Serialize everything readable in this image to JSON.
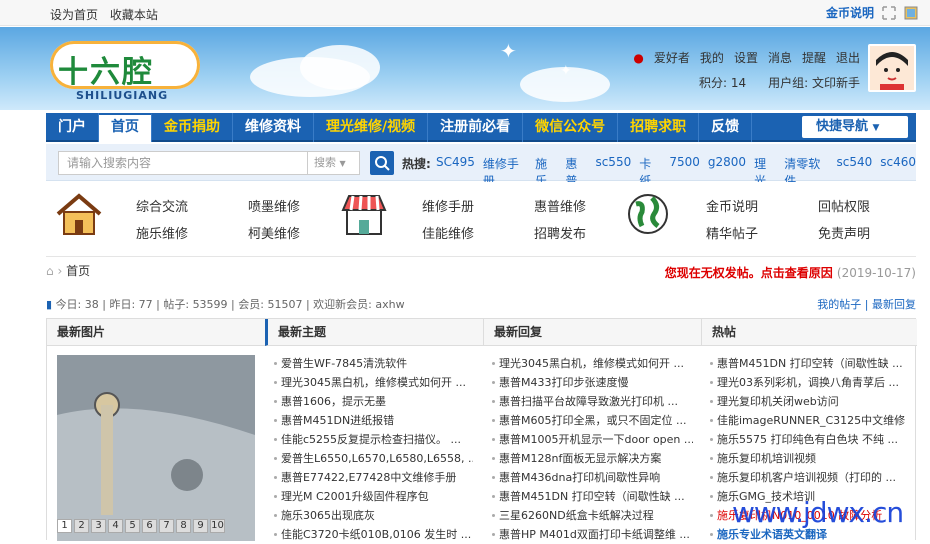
{
  "topbar": {
    "set_home": "设为首页",
    "bookmark": "收藏本站",
    "coin_help": "金币说明"
  },
  "logo": {
    "cn": "十六腔",
    "en": "SHILIUGIANG"
  },
  "user": {
    "name": "爱好者",
    "mine": "我的",
    "settings": "设置",
    "messages": "消息",
    "remind": "提醒",
    "logout": "退出",
    "points": "积分: 14",
    "group": "用户组: 文印新手"
  },
  "nav": {
    "items": [
      "门户",
      "首页",
      "金币捐助",
      "维修资料",
      "理光维修/视频",
      "注册前必看",
      "微信公众号",
      "招聘求职",
      "反馈"
    ],
    "quick": "快捷导航"
  },
  "search": {
    "placeholder": "请输入搜索内容",
    "select": "搜索",
    "hot_label": "热搜:",
    "hot": [
      "SC495",
      "维修手册",
      "施乐",
      "惠普",
      "sc550",
      "卡纸",
      "7500",
      "g2800",
      "理光",
      "清零软件",
      "sc540",
      "sc460"
    ]
  },
  "quicklinks": [
    "综合交流",
    "喷墨维修",
    "维修手册",
    "惠普维修",
    "金币说明",
    "回帖权限",
    "施乐维修",
    "柯美维修",
    "佳能维修",
    "招聘发布",
    "精华帖子",
    "免责声明"
  ],
  "crumb": {
    "home": "首页",
    "notice": "您现在无权发帖。点击查看原因",
    "date": "(2019-10-17)"
  },
  "stats": {
    "text": "今日: 38 | 昨日: 77 | 帖子: 53599 | 会员: 51507 | 欢迎新会员: axhw",
    "my_posts": "我的帖子",
    "latest": "最新回复"
  },
  "columns": {
    "heads": [
      "最新图片",
      "最新主题",
      "最新回复",
      "热帖"
    ],
    "pager": [
      "1",
      "2",
      "3",
      "4",
      "5",
      "6",
      "7",
      "8",
      "9",
      "10"
    ],
    "topics": [
      "爱普生WF-7845清洗软件",
      "理光3045黑白机，维修模式如何开 ...",
      "惠普1606，提示无墨",
      "惠普M451DN进纸报错",
      "佳能c5255反复提示检查扫描仪。 ...",
      "爱普生L6550,L6570,L6580,L6558, ...",
      "惠普E77422,E77428中文维修手册",
      "理光M C2001升级固件程序包",
      "施乐3065出现底灰",
      "佳能C3720卡纸010B,0106 发生时 ..."
    ],
    "replies": [
      "理光3045黑白机，维修模式如何开 ...",
      "惠普M433打印步张速度慢",
      "惠普扫描平台故障导致激光打印机 ...",
      "惠普M605打印全黑，或只不固定位 ...",
      "惠普M1005开机显示一下door open ...",
      "惠普M128nf面板无显示解决方案",
      "惠普M436dna打印机间歇性异响",
      "惠普M451DN 打印空转（间歇性缺 ...",
      "三星6260ND纸盒卡纸解决过程",
      "惠普HP M401d双面打印卡纸调整维 ..."
    ],
    "hot": [
      "惠普M451DN 打印空转（间歇性缺 ...",
      "理光03系列彩机，调换八角青莩后 ...",
      "理光复印机关闭web访问",
      "佳能imageRUNNER_C3125中文维修 ...",
      "施乐5575 打印纯色有白色块 不纯 ...",
      "施乐复印机培训视频",
      "施乐复印机客户培训视频（打印的 ...",
      "施乐GMG_技术培训",
      "施乐复印机N010_0010 故障分析",
      "施乐专业术语英文翻译"
    ]
  },
  "watermark": "www.jdwx.cn"
}
